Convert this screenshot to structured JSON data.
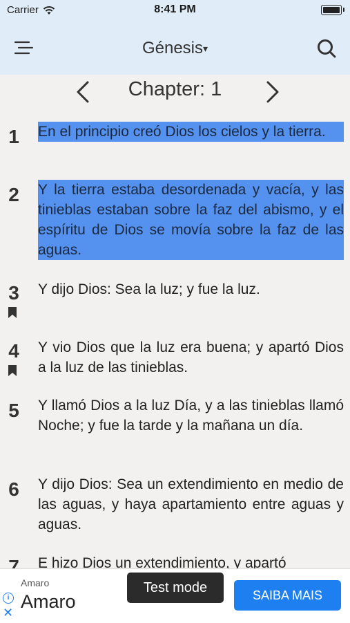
{
  "status_bar": {
    "carrier": "Carrier",
    "time": "8:41 PM"
  },
  "nav": {
    "book": "Génesis",
    "dropdown_glyph": "▾"
  },
  "chapter": {
    "label": "Chapter: 1"
  },
  "verses": [
    {
      "num": "1",
      "text": "En el principio creó Dios los cielos y la tierra.",
      "highlighted": true,
      "bookmarked": false
    },
    {
      "num": "2",
      "text": "Y la tierra estaba desordenada y vacía, y las tinieblas estaban sobre la faz del abismo, y el espíritu de Dios se movía sobre la faz de las aguas.",
      "highlighted": true,
      "bookmarked": false
    },
    {
      "num": "3",
      "text": "Y dijo Dios: Sea la luz; y fue la luz.",
      "highlighted": false,
      "bookmarked": true
    },
    {
      "num": "4",
      "text": "Y vio Dios que la luz era buena; y apartó Dios a la luz de las tinieblas.",
      "highlighted": false,
      "bookmarked": true
    },
    {
      "num": "5",
      "text": "Y llamó Dios a la luz Día, y a las tinieblas llamó Noche; y fue la tarde y la mañana un día.",
      "highlighted": false,
      "bookmarked": false
    },
    {
      "num": "6",
      "text": "Y dijo Dios: Sea un extendimiento en medio de las aguas, y haya apartamiento entre aguas y aguas.",
      "highlighted": false,
      "bookmarked": false
    },
    {
      "num": "7",
      "text": "E hizo Dios un extendimiento, y apartó",
      "highlighted": false,
      "bookmarked": false
    }
  ],
  "ad": {
    "advertiser_small": "Amaro",
    "advertiser_name": "Amaro",
    "test_label": "Test mode",
    "cta_label": "SAIBA MAIS",
    "info_glyph": "i",
    "close_glyph": "✕"
  },
  "colors": {
    "header_bg": "#e0edf8",
    "highlight": "#5591ee",
    "cta": "#1e80f0"
  }
}
